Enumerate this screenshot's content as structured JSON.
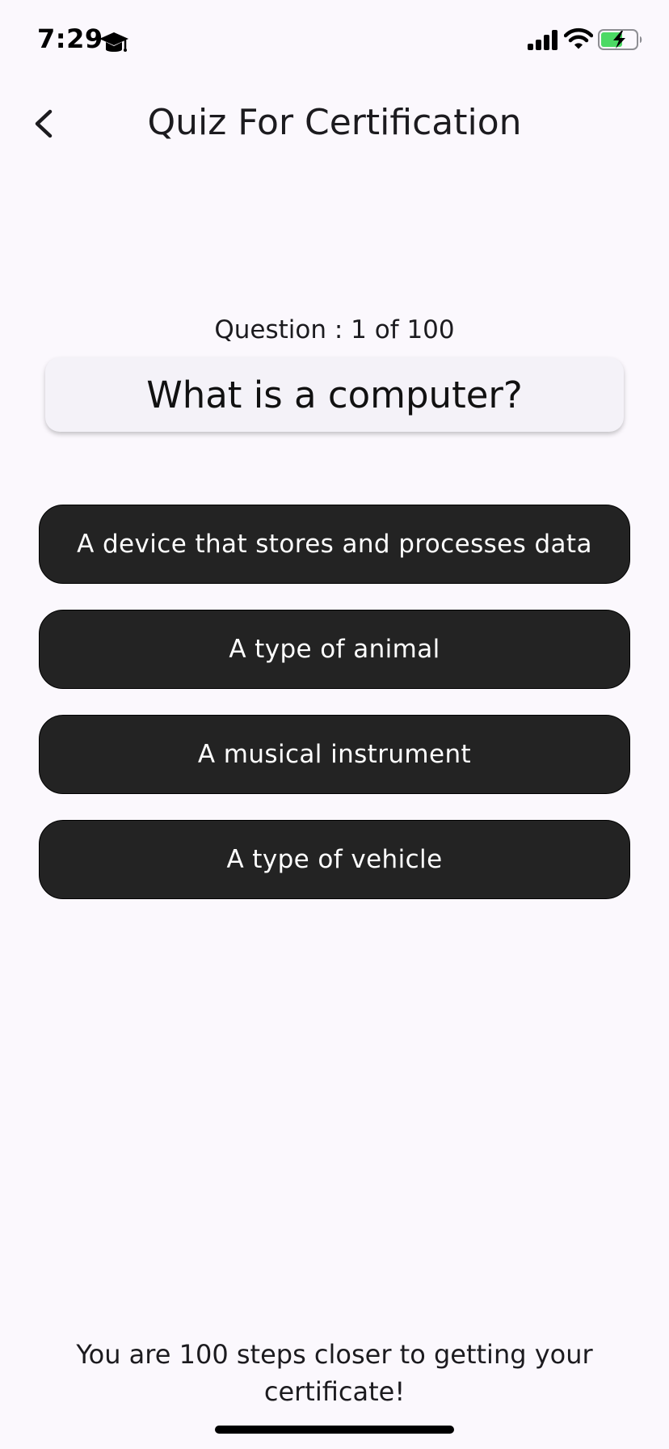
{
  "status_bar": {
    "time": "7:29",
    "notification_icon": "graduation-cap-icon",
    "signal_icon": "cellular-signal-icon",
    "wifi_icon": "wifi-icon",
    "battery_icon": "battery-charging-icon",
    "battery_color": "#4cd964"
  },
  "app_bar": {
    "back_icon": "chevron-left-icon",
    "title": "Quiz For Certification"
  },
  "quiz": {
    "counter": "Question : 1 of 100",
    "question": "What is a computer?",
    "options": [
      "A device that stores and processes data",
      "A type of animal",
      "A musical instrument",
      "A type of vehicle"
    ]
  },
  "footer": {
    "message": "You are 100 steps closer to getting your certificate!"
  },
  "colors": {
    "background": "#fbf8fd",
    "option_background": "#232323",
    "option_text": "#ffffff",
    "question_card": "#f4f2f8"
  }
}
